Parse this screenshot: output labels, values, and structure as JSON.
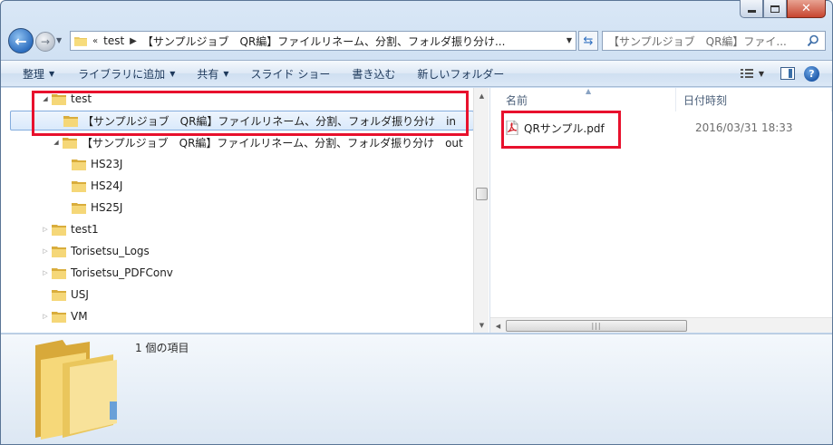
{
  "window": {
    "minimize_label": "—",
    "maximize_label": "□",
    "close_label": "✕"
  },
  "address_bar": {
    "prefix": "«",
    "crumbs": [
      "test",
      "【サンプルジョブ　QR編】ファイルリネーム、分割、フォルダ振り分け..."
    ]
  },
  "search": {
    "placeholder": "【サンプルジョブ　QR編】ファイ..."
  },
  "commands": {
    "organize": "整理",
    "add_to_library": "ライブラリに追加",
    "share": "共有",
    "slideshow": "スライド ショー",
    "burn": "書き込む",
    "new_folder": "新しいフォルダー",
    "help": "?"
  },
  "tree": [
    {
      "label": "test",
      "expander": "expanded"
    },
    {
      "label": "【サンプルジョブ　QR編】ファイルリネーム、分割、フォルダ振り分け　in",
      "expander": "none",
      "selected": true
    },
    {
      "label": "【サンプルジョブ　QR編】ファイルリネーム、分割、フォルダ振り分け　out",
      "expander": "expanded"
    },
    {
      "label": "HS23J",
      "expander": "none"
    },
    {
      "label": "HS24J",
      "expander": "none"
    },
    {
      "label": "HS25J",
      "expander": "none"
    },
    {
      "label": "test1",
      "expander": "collapsed"
    },
    {
      "label": "Torisetsu_Logs",
      "expander": "collapsed"
    },
    {
      "label": "Torisetsu_PDFConv",
      "expander": "collapsed"
    },
    {
      "label": "USJ",
      "expander": "none"
    },
    {
      "label": "VM",
      "expander": "collapsed"
    }
  ],
  "content": {
    "col_name": "名前",
    "col_date": "日付時刻",
    "files": [
      {
        "name": "QRサンプル.pdf",
        "date": "2016/03/31 18:33"
      }
    ]
  },
  "details": {
    "item_count": "1 個の項目"
  },
  "colors": {
    "annotation": "#e8112d",
    "selection": "#d9e9fb"
  }
}
